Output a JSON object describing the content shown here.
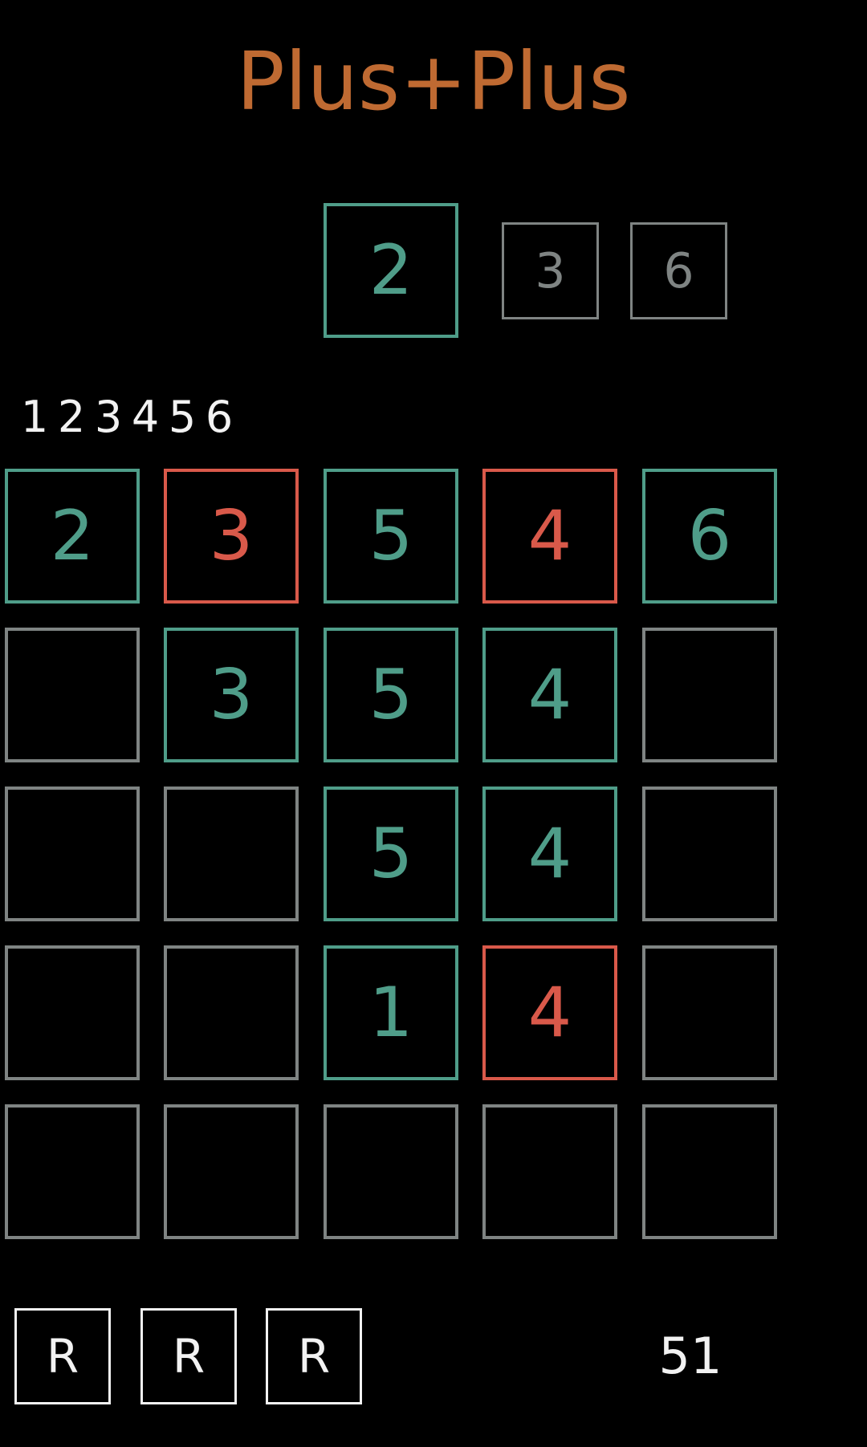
{
  "title": "Plus+Plus",
  "queue": {
    "current": "2",
    "next": [
      "3",
      "6"
    ]
  },
  "digit_row": [
    "1",
    "2",
    "3",
    "4",
    "5",
    "6"
  ],
  "board": [
    [
      {
        "v": "2",
        "s": "green"
      },
      {
        "v": "3",
        "s": "red"
      },
      {
        "v": "5",
        "s": "green"
      },
      {
        "v": "4",
        "s": "red"
      },
      {
        "v": "6",
        "s": "green"
      }
    ],
    [
      {
        "v": "",
        "s": "empty"
      },
      {
        "v": "3",
        "s": "green"
      },
      {
        "v": "5",
        "s": "green"
      },
      {
        "v": "4",
        "s": "green"
      },
      {
        "v": "",
        "s": "empty"
      }
    ],
    [
      {
        "v": "",
        "s": "empty"
      },
      {
        "v": "",
        "s": "empty"
      },
      {
        "v": "5",
        "s": "green"
      },
      {
        "v": "4",
        "s": "green"
      },
      {
        "v": "",
        "s": "empty"
      }
    ],
    [
      {
        "v": "",
        "s": "empty"
      },
      {
        "v": "",
        "s": "empty"
      },
      {
        "v": "1",
        "s": "green"
      },
      {
        "v": "4",
        "s": "red"
      },
      {
        "v": "",
        "s": "empty"
      }
    ],
    [
      {
        "v": "",
        "s": "empty"
      },
      {
        "v": "",
        "s": "empty"
      },
      {
        "v": "",
        "s": "empty"
      },
      {
        "v": "",
        "s": "empty"
      },
      {
        "v": "",
        "s": "empty"
      }
    ]
  ],
  "buttons": {
    "r1": "R",
    "r2": "R",
    "r3": "R"
  },
  "score": "51",
  "colors": {
    "title": "#bf6a32",
    "green": "#4f9d89",
    "red": "#d9594a",
    "empty": "#7f8483",
    "text": "#f2f2f2",
    "background": "#000000"
  }
}
